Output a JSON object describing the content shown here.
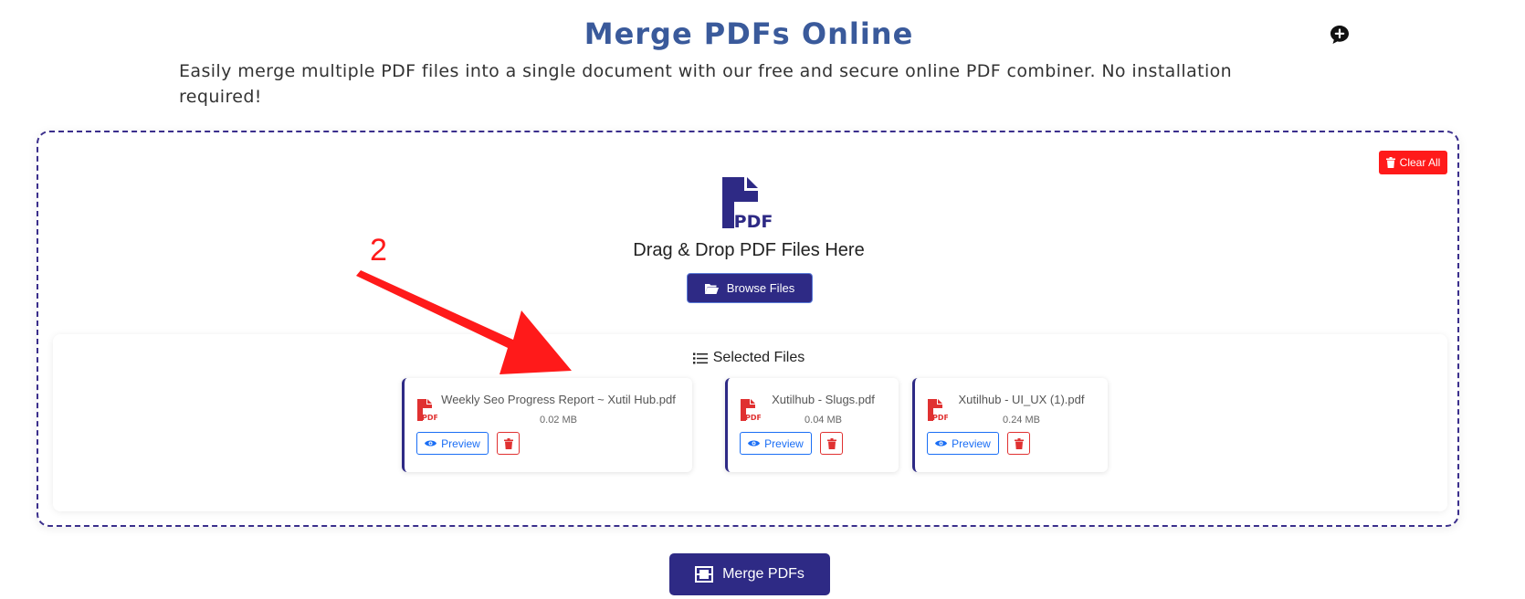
{
  "header": {
    "title": "Merge PDFs Online",
    "subtitle": "Easily merge multiple PDF files into a single document with our free and secure online PDF combiner. No installation required!"
  },
  "dropzone": {
    "clear_all_label": "Clear All",
    "drag_text": "Drag & Drop PDF Files Here",
    "pdf_icon_text": "PDF",
    "browse_label": "Browse Files"
  },
  "selected": {
    "title": "Selected Files",
    "files": [
      {
        "name": "Weekly Seo Progress Report ~ Xutil Hub.pdf",
        "size": "0.02 MB",
        "preview_label": "Preview"
      },
      {
        "name": "Xutilhub - Slugs.pdf",
        "size": "0.04 MB",
        "preview_label": "Preview"
      },
      {
        "name": "Xutilhub - UI_UX (1).pdf",
        "size": "0.24 MB",
        "preview_label": "Preview"
      }
    ]
  },
  "merge": {
    "label": "Merge PDFs"
  },
  "annotation": {
    "number": "2"
  },
  "colors": {
    "title": "#3a5a9b",
    "primary": "#2e2a85",
    "danger": "#ff1a1a",
    "preview": "#1a6ef5",
    "pdf_icon_small": "#e03131"
  },
  "icons": [
    "chat-plus-icon",
    "trash-icon",
    "pdf-file-icon",
    "folder-open-icon",
    "list-icon",
    "eye-icon",
    "merge-icon",
    "annotation-arrow"
  ]
}
